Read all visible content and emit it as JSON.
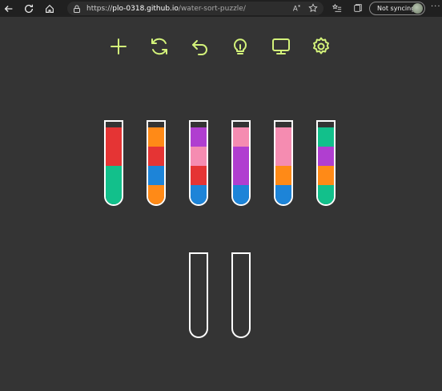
{
  "browser": {
    "url_protocol": "https://",
    "url_host": "plo-0318.github.io",
    "url_path": "/water-sort-puzzle/",
    "sync_label": "Not syncing"
  },
  "toolbar": {
    "icons": [
      "add-icon",
      "restart-icon",
      "undo-icon",
      "hint-icon",
      "display-icon",
      "settings-icon"
    ],
    "accent_color": "#d3f27a"
  },
  "colors": {
    "red": "#e53434",
    "green": "#12c08b",
    "orange": "#ff8a17",
    "blue": "#1d84d8",
    "purple": "#b03ed0",
    "pink": "#f58cb1"
  },
  "tubes": [
    {
      "layers": [
        "green",
        "green",
        "red",
        "red"
      ]
    },
    {
      "layers": [
        "orange",
        "blue",
        "red",
        "orange"
      ]
    },
    {
      "layers": [
        "blue",
        "red",
        "pink",
        "purple"
      ]
    },
    {
      "layers": [
        "blue",
        "purple",
        "purple",
        "pink"
      ]
    },
    {
      "layers": [
        "blue",
        "orange",
        "pink",
        "pink"
      ]
    },
    {
      "layers": [
        "green",
        "orange",
        "purple",
        "green"
      ]
    },
    {
      "layers": []
    },
    {
      "layers": []
    }
  ]
}
